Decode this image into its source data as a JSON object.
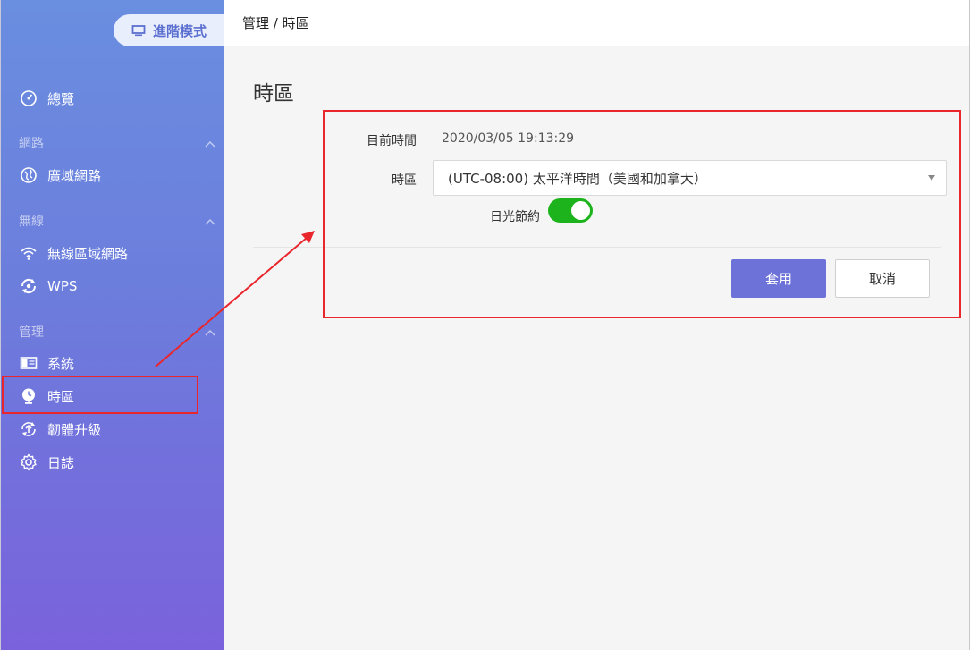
{
  "sidebar": {
    "mode_label": "進階模式",
    "overview": "總覽",
    "sections": {
      "network": "網路",
      "wireless": "無線",
      "management": "管理"
    },
    "items": {
      "wan": "廣域網路",
      "wlan": "無線區域網路",
      "wps": "WPS",
      "system": "系統",
      "timezone": "時區",
      "firmware": "韌體升級",
      "log": "日誌"
    }
  },
  "topbar": {
    "breadcrumb": "管理 / 時區"
  },
  "main": {
    "title": "時區",
    "current_time_label": "目前時間",
    "current_time_value": "2020/03/05 19:13:29",
    "timezone_label": "時區",
    "timezone_value": "(UTC-08:00) 太平洋時間（美國和加拿大）",
    "dst_label": "日光節約",
    "dst_enabled": true,
    "apply_label": "套用",
    "cancel_label": "取消"
  },
  "colors": {
    "accent": "#6d72d8",
    "toggle_on": "#1cb31c",
    "annotation": "#e8262c"
  }
}
